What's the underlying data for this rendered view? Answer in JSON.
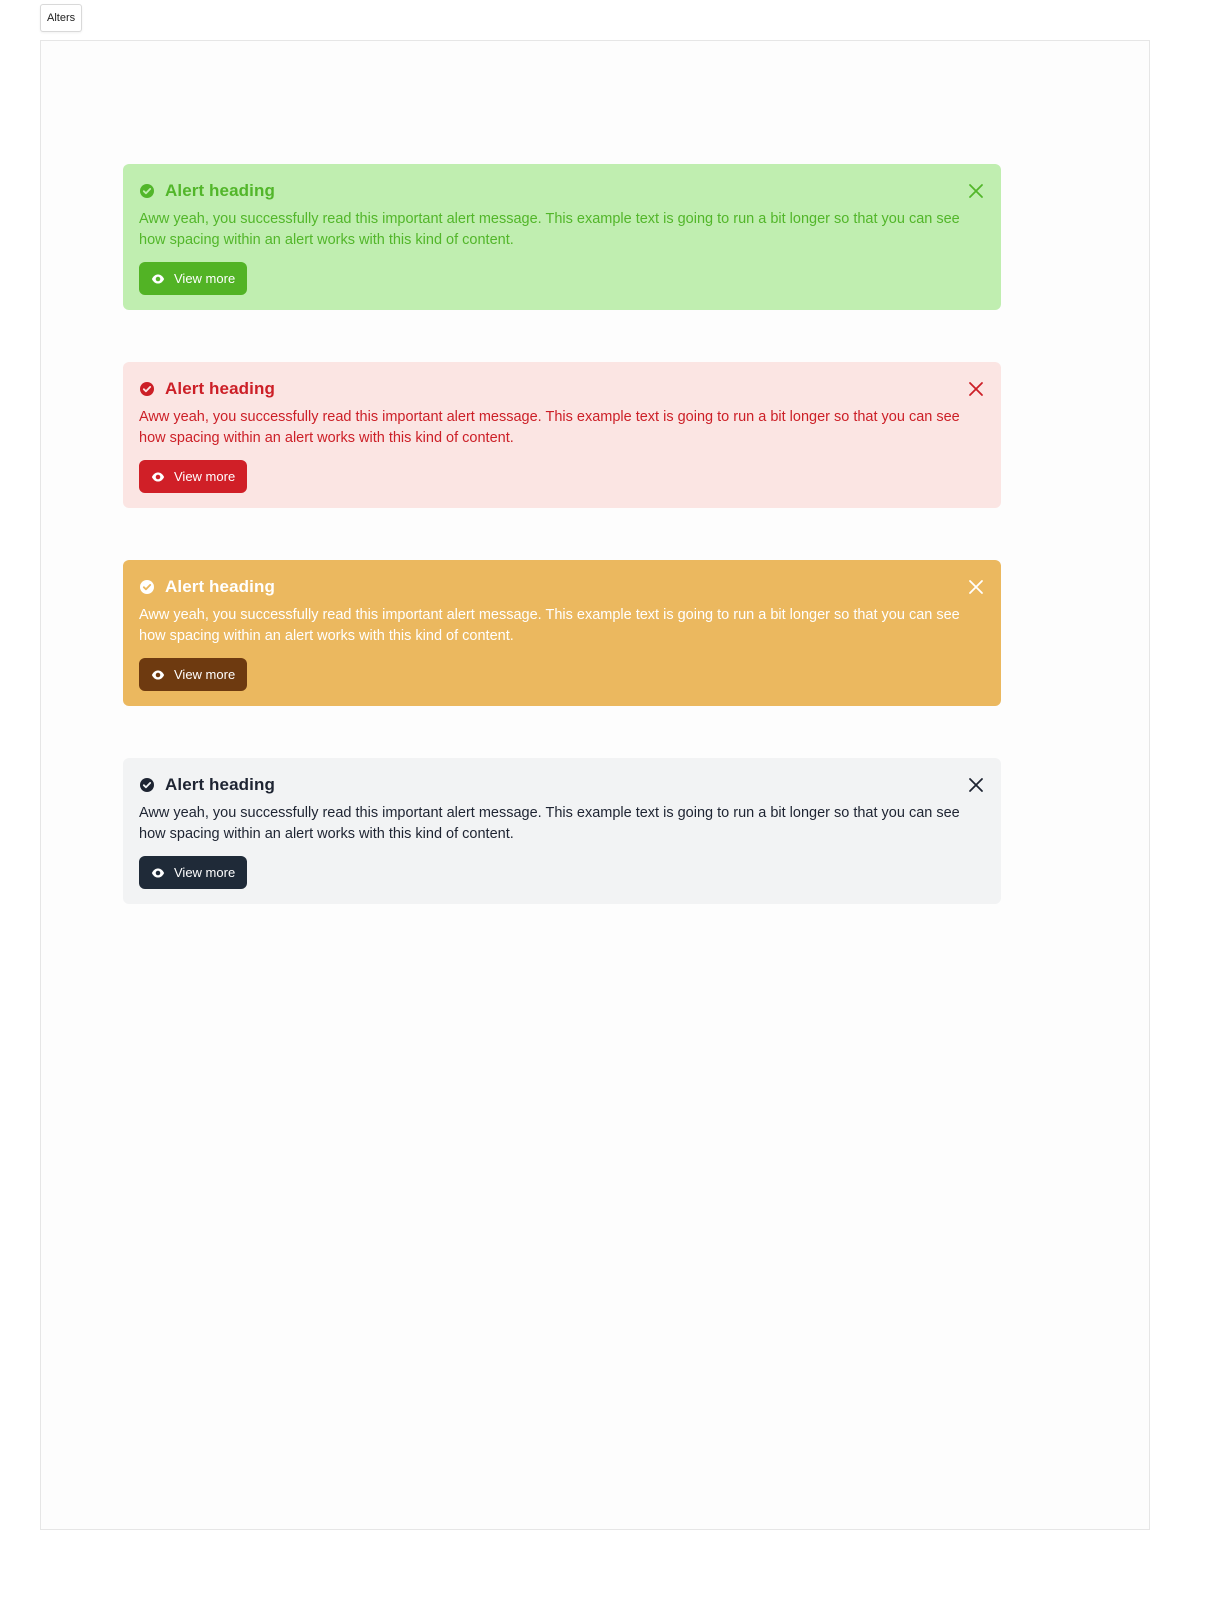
{
  "tab": {
    "label": "Alters"
  },
  "alerts": [
    {
      "variant": "success",
      "status_icon": "check-circle-icon",
      "title": "Alert heading",
      "body": "Aww yeah, you successfully read this important alert message. This example text is going to run a bit longer so that you can see how spacing within an alert works with this kind of content.",
      "button_label": "View more",
      "button_icon": "eye-icon",
      "close_icon": "close-icon",
      "colors": {
        "background": "#c0eeb0",
        "text": "#52b62a",
        "button": "#52b325"
      }
    },
    {
      "variant": "danger",
      "status_icon": "check-circle-icon",
      "title": "Alert heading",
      "body": "Aww yeah, you successfully read this important alert message. This example text is going to run a bit longer so that you can see how spacing within an alert works with this kind of content.",
      "button_label": "View more",
      "button_icon": "eye-icon",
      "close_icon": "close-icon",
      "colors": {
        "background": "#fbe5e3",
        "text": "#cc1f27",
        "button": "#d01f27"
      }
    },
    {
      "variant": "warning",
      "status_icon": "check-circle-icon",
      "title": "Alert heading",
      "body": "Aww yeah, you successfully read this important alert message. This example text is going to run a bit longer so that you can see how spacing within an alert works with this kind of content.",
      "button_label": "View more",
      "button_icon": "eye-icon",
      "close_icon": "close-icon",
      "colors": {
        "background": "#ebb85f",
        "text": "#ffffff",
        "button": "#6e3a10"
      }
    },
    {
      "variant": "dark",
      "status_icon": "check-circle-icon",
      "title": "Alert heading",
      "body": "Aww yeah, you successfully read this important alert message. This example text is going to run a bit longer so that you can see how spacing within an alert works with this kind of content.",
      "button_label": "View more",
      "button_icon": "eye-icon",
      "close_icon": "close-icon",
      "colors": {
        "background": "#f2f3f4",
        "text": "#1e2432",
        "button": "#1f2a38"
      }
    }
  ]
}
